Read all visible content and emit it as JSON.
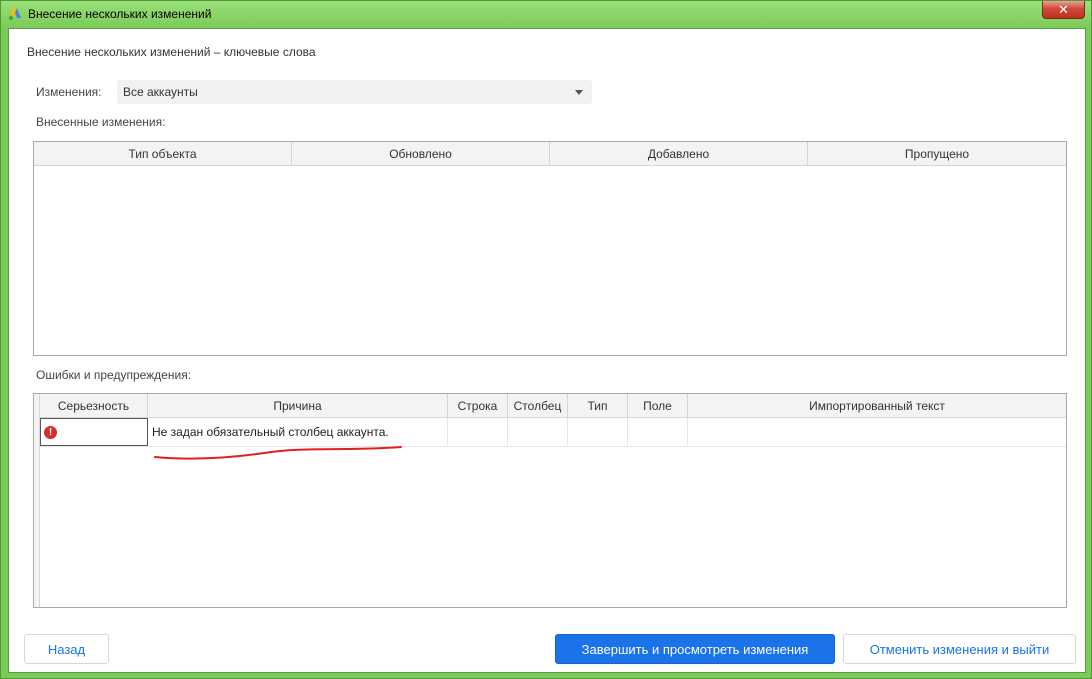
{
  "window": {
    "title": "Внесение нескольких изменений"
  },
  "dialog": {
    "heading": "Внесение нескольких изменений – ключевые слова",
    "changes_label": "Изменения:",
    "changes_select_value": "Все аккаунты",
    "applied_label": "Внесенные изменения:",
    "errors_label": "Ошибки и предупреждения:"
  },
  "changes_table": {
    "columns": [
      "Тип объекта",
      "Обновлено",
      "Добавлено",
      "Пропущено"
    ]
  },
  "errors_table": {
    "columns": [
      "Серьезность",
      "Причина",
      "Строка",
      "Столбец",
      "Тип",
      "Поле",
      "Импортированный текст"
    ],
    "rows": [
      {
        "severity_icon": "error-icon",
        "reason": "Не задан обязательный столбец аккаунта.",
        "row": "",
        "column": "",
        "type": "",
        "field": "",
        "imported_text": ""
      }
    ]
  },
  "buttons": {
    "back": "Назад",
    "finish": "Завершить и просмотреть изменения",
    "cancel": "Отменить изменения и выйти"
  },
  "colors": {
    "primary": "#1a73e8",
    "error": "#d32f2f",
    "annotation": "#e02020"
  }
}
